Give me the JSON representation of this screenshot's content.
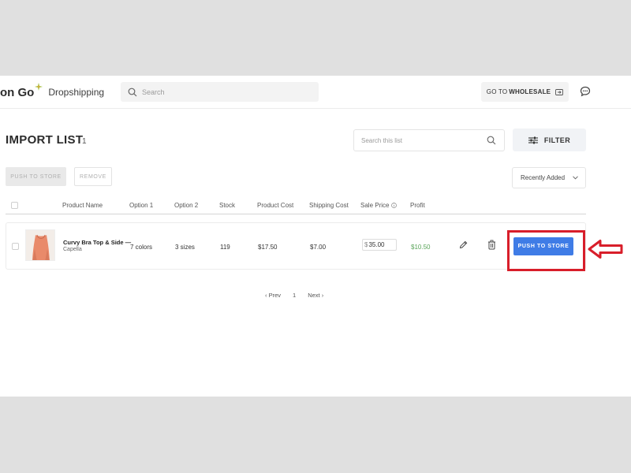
{
  "header": {
    "logo_main": "on Go",
    "logo_sub": "Dropshipping",
    "search_placeholder": "Search",
    "wholesale_prefix": "GO TO",
    "wholesale_bold": "WHOLESALE"
  },
  "page": {
    "title": "IMPORT LIST",
    "count": "1",
    "list_search_placeholder": "Search this list",
    "filter_label": "FILTER",
    "bulk_push_label": "PUSH TO STORE",
    "bulk_remove_label": "REMOVE",
    "sort_value": "Recently Added"
  },
  "table": {
    "columns": [
      "Product Name",
      "Option 1",
      "Option 2",
      "Stock",
      "Product Cost",
      "Shipping Cost",
      "Sale Price",
      "Profit"
    ],
    "rows": [
      {
        "name": "Curvy Bra Top & Side —",
        "brand": "Capella",
        "option1": "7 colors",
        "option2": "3 sizes",
        "stock": "119",
        "product_cost": "$17.50",
        "shipping_cost": "$7.00",
        "sale_currency": "$",
        "sale_price": "35.00",
        "profit": "$10.50",
        "push_label": "PUSH TO STORE"
      }
    ]
  },
  "pagination": {
    "prev": "‹ Prev",
    "page": "1",
    "next": "Next ›"
  },
  "colors": {
    "accent": "#3f7ce6",
    "highlight": "#d81e2a",
    "profit": "#5aa55a"
  },
  "icons": [
    "search-icon",
    "external-link-icon",
    "chat-icon",
    "filter-sliders-icon",
    "chevron-down-icon",
    "edit-icon",
    "trash-icon",
    "arrow-left-icon",
    "info-icon"
  ]
}
